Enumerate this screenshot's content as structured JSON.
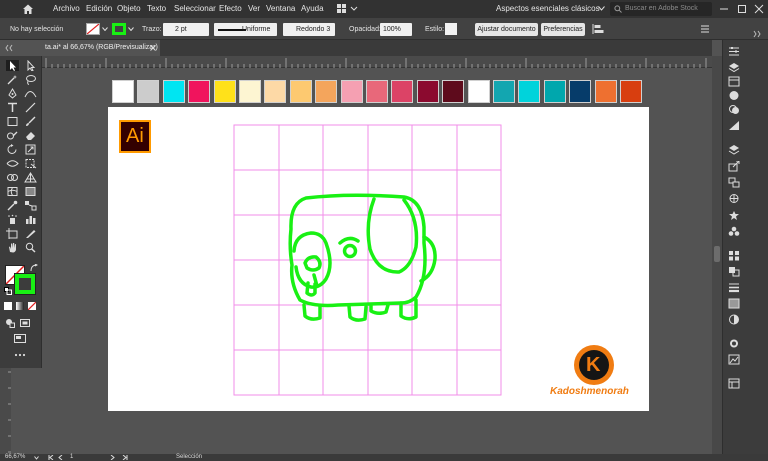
{
  "menu": [
    "Archivo",
    "Edición",
    "Objeto",
    "Texto",
    "Seleccionar",
    "Efecto",
    "Ver",
    "Ventana",
    "Ayuda"
  ],
  "workspace": "Aspectos esenciales clásicos",
  "stock_search_placeholder": "Buscar en Adobe Stock",
  "control": {
    "selection": "No hay selección",
    "stroke_label": "Trazo:",
    "stroke_weight": "2 pt",
    "profile": "Uniforme",
    "brush": "Redondo 3 ...",
    "opacity_label": "Opacidad:",
    "opacity": "100%",
    "style_label": "Estilo:",
    "adjust_document": "Ajustar documento",
    "preferences": "Preferencias"
  },
  "document_tab": "ta.ai* al 66,67% (RGB/Previsualizar)",
  "status": {
    "zoom": "66,67%",
    "artboard_number": "1",
    "tool": "Selección"
  },
  "logo_text": "Ai",
  "watermark": {
    "letter": "K",
    "name": "Kadoshmenorah"
  },
  "swatches": [
    "#ffffff",
    "#cccccc",
    "#00e5f2",
    "#f0145d",
    "#ffe11a",
    "#fdf5d2",
    "#fdd9a6",
    "#fdc970",
    "#f4a55c",
    "#f5a0b2",
    "#e8687a",
    "#dc4366",
    "#8b0a2f",
    "#5e0b1c",
    "#ffffff",
    "#13a6b0",
    "#00d3db",
    "#00a7ad",
    "#063c6a",
    "#ee7030",
    "#d83e0f"
  ],
  "colors": {
    "drawing": "#19f014",
    "grid": "#f28ee8",
    "fill_stroke": "#19f014"
  }
}
